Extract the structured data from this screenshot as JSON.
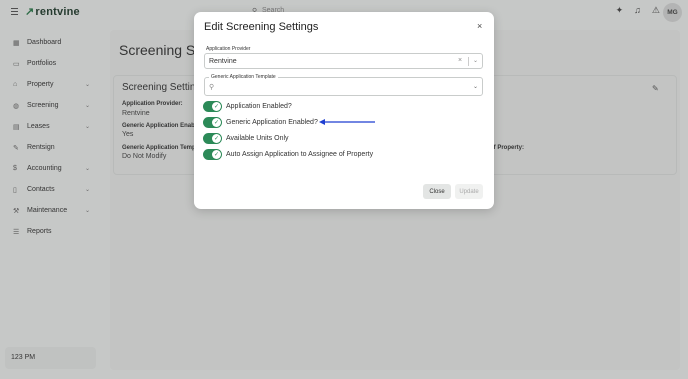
{
  "app": {
    "brand": "rentvine",
    "search_placeholder": "Search",
    "avatar_initials": "MG",
    "icons": [
      "sparkle-icon",
      "bell-icon",
      "alert-icon"
    ]
  },
  "sidebar": {
    "items": [
      {
        "label": "Dashboard",
        "icon": "grid-icon",
        "has_chevron": false
      },
      {
        "label": "Portfolios",
        "icon": "folder-icon",
        "has_chevron": false
      },
      {
        "label": "Property",
        "icon": "building-icon",
        "has_chevron": true
      },
      {
        "label": "Screening",
        "icon": "screening-icon",
        "has_chevron": true
      },
      {
        "label": "Leases",
        "icon": "lease-icon",
        "has_chevron": true
      },
      {
        "label": "Rentsign",
        "icon": "pen-icon",
        "has_chevron": false
      },
      {
        "label": "Accounting",
        "icon": "dollar-icon",
        "has_chevron": true
      },
      {
        "label": "Contacts",
        "icon": "contacts-icon",
        "has_chevron": true
      },
      {
        "label": "Maintenance",
        "icon": "wrench-icon",
        "has_chevron": true
      },
      {
        "label": "Reports",
        "icon": "reports-icon",
        "has_chevron": false
      }
    ],
    "footer_text": "123 PM"
  },
  "page": {
    "title": "Screening Se",
    "card_title": "Screening Setting",
    "fields": {
      "provider_label": "Application Provider:",
      "provider_value": "Rentvine",
      "generic_label": "Generic Application Enab",
      "generic_value": "Yes",
      "template_label": "Generic Application Temp",
      "template_value": "Do Not Modify",
      "assign_label": "e of Property:"
    }
  },
  "modal": {
    "title": "Edit Screening Settings",
    "close_icon": "×",
    "provider": {
      "label": "Application Provider",
      "value": "Rentvine"
    },
    "template": {
      "label": "Generic Application Template",
      "value": ""
    },
    "toggles": [
      {
        "label": "Application Enabled?",
        "on": true
      },
      {
        "label": "Generic Application Enabled?",
        "on": true
      },
      {
        "label": "Available Units Only",
        "on": true
      },
      {
        "label": "Auto Assign Application to Assignee of Property",
        "on": true
      }
    ],
    "buttons": {
      "close": "Close",
      "update": "Update"
    },
    "arrow_color": "#1f3fd1",
    "toggle_color": "#2c8a58"
  }
}
